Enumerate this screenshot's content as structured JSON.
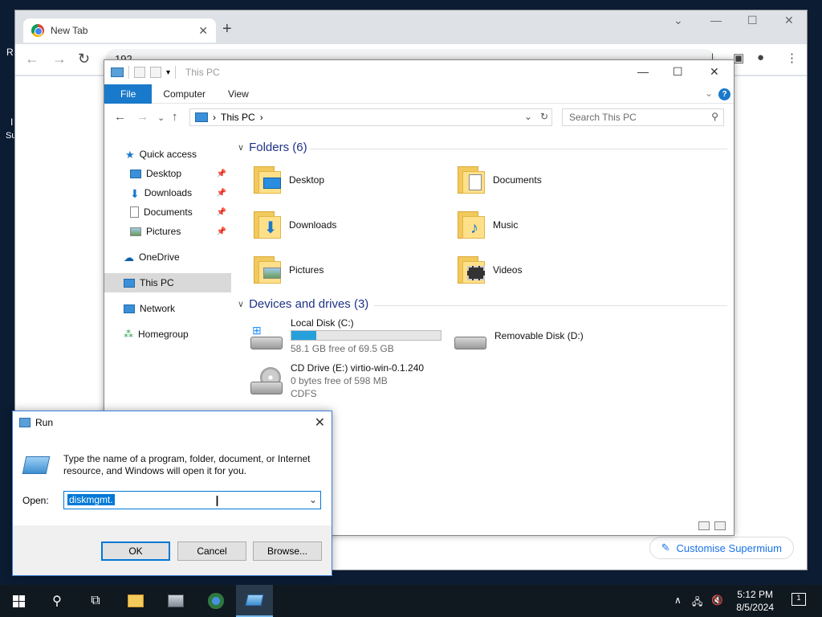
{
  "desktop": {
    "fragments": [
      "R",
      "I",
      "Su"
    ]
  },
  "browser": {
    "tab_title": "New Tab",
    "address_text": "192",
    "customise_label": "Customise Supermium",
    "customise_icon": "pencil-icon"
  },
  "explorer": {
    "window_title": "This PC",
    "ribbon_tabs": [
      "File",
      "Computer",
      "View"
    ],
    "breadcrumb": [
      "This PC"
    ],
    "search_placeholder": "Search This PC",
    "nav": {
      "quick_access": "Quick access",
      "desktop": "Desktop",
      "downloads": "Downloads",
      "documents": "Documents",
      "pictures": "Pictures",
      "onedrive": "OneDrive",
      "this_pc": "This PC",
      "network": "Network",
      "homegroup": "Homegroup"
    },
    "folders_header": "Folders (6)",
    "folders": [
      {
        "name": "Desktop",
        "icon": "desktop-folder-icon"
      },
      {
        "name": "Documents",
        "icon": "documents-folder-icon"
      },
      {
        "name": "Downloads",
        "icon": "downloads-folder-icon"
      },
      {
        "name": "Music",
        "icon": "music-folder-icon"
      },
      {
        "name": "Pictures",
        "icon": "pictures-folder-icon"
      },
      {
        "name": "Videos",
        "icon": "videos-folder-icon"
      }
    ],
    "drives_header": "Devices and drives (3)",
    "drives": {
      "c": {
        "name": "Local Disk (C:)",
        "free": "58.1 GB free of 69.5 GB",
        "used_fraction": 0.164
      },
      "d": {
        "name": "Removable Disk (D:)"
      },
      "e": {
        "name": "CD Drive (E:) virtio-win-0.1.240",
        "free": "0 bytes free of 598 MB",
        "fs": "CDFS"
      }
    },
    "accent": "#1979ca"
  },
  "run": {
    "title": "Run",
    "description": "Type the name of a program, folder, document, or Internet resource, and Windows will open it for you.",
    "open_label": "Open:",
    "value": "diskmgmt.",
    "ok": "OK",
    "cancel": "Cancel",
    "browse": "Browse..."
  },
  "taskbar": {
    "time": "5:12 PM",
    "date": "8/5/2024",
    "notification_count": "1"
  }
}
